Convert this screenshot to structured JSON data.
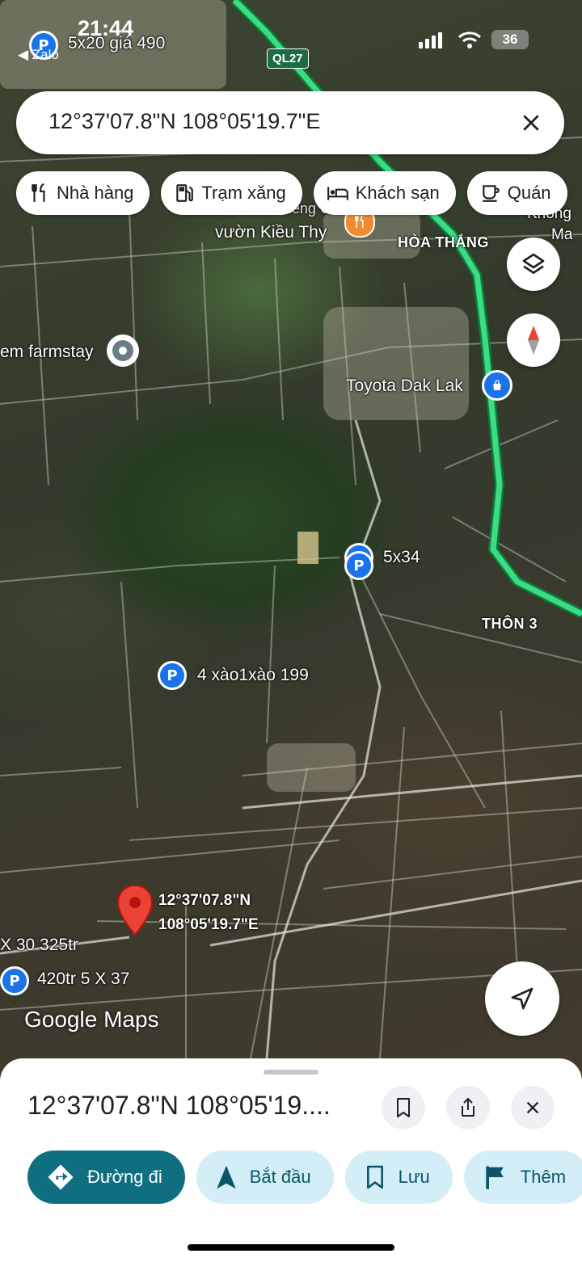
{
  "status_bar": {
    "time": "21:44",
    "back_app": "◀ Zalo",
    "battery": "36"
  },
  "search": {
    "query": "12°37'07.8\"N 108°05'19.7\"E"
  },
  "chips": [
    {
      "label": "Nhà hàng",
      "icon": "fork-knife-icon"
    },
    {
      "label": "Trạm xăng",
      "icon": "gas-station-icon"
    },
    {
      "label": "Khách sạn",
      "icon": "bed-icon"
    },
    {
      "label": "Quán",
      "icon": "cup-icon"
    }
  ],
  "map": {
    "road_badge": "QL27",
    "labels": {
      "parking_top": "5x20 giá 490",
      "vuon": "vườn Kiều Thy",
      "vuon_top": "Vườn Sầu Riêng Cà Phê Sân",
      "hoa_thang": "HÒA THẮNG",
      "khong": "Không",
      "ma": "Ma",
      "farmstay": "em farmstay",
      "toyota": "Toyota Dak Lak",
      "p_5x34": "5x34",
      "thon3": "THÔN 3",
      "p_4xao": "4 xào1xào 199",
      "dropped_pin_lat": "12°37'07.8\"N",
      "dropped_pin_lng": "108°05'19.7\"E",
      "x30": "X 30 325tr",
      "p_420": "420tr  5 X 37",
      "watermark": "Google Maps"
    }
  },
  "sheet": {
    "title": "12°37'07.8\"N 108°05'19....",
    "actions": [
      {
        "label": "Đường đi"
      },
      {
        "label": "Bắt đầu"
      },
      {
        "label": "Lưu"
      },
      {
        "label": "Thêm"
      }
    ]
  },
  "colors": {
    "primary_action": "#0f6f80",
    "secondary_action": "#d3eef7",
    "route": "#3ddc84",
    "pin": "#ea4335",
    "parking": "#1a73e8"
  }
}
